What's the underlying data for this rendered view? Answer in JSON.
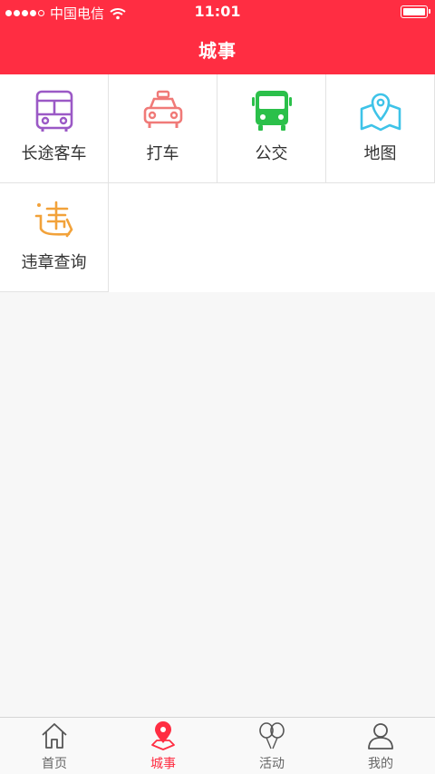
{
  "status_bar": {
    "carrier": "中国电信",
    "time": "11:01"
  },
  "header": {
    "title": "城事"
  },
  "services": [
    {
      "label": "长途客车",
      "icon": "bus-icon",
      "color": "#9b59c6"
    },
    {
      "label": "打车",
      "icon": "taxi-icon",
      "color": "#f07a78"
    },
    {
      "label": "公交",
      "icon": "city-bus-icon",
      "color": "#2bc04a"
    },
    {
      "label": "地图",
      "icon": "map-icon",
      "color": "#3ec3e8"
    },
    {
      "label": "违章查询",
      "icon": "violation-icon",
      "color": "#f2a23a"
    }
  ],
  "tabs": [
    {
      "label": "首页",
      "icon": "home-icon",
      "active": false
    },
    {
      "label": "城事",
      "icon": "location-icon",
      "active": true
    },
    {
      "label": "活动",
      "icon": "balloons-icon",
      "active": false
    },
    {
      "label": "我的",
      "icon": "user-icon",
      "active": false
    }
  ],
  "colors": {
    "brand": "#ff2d42",
    "tab_inactive": "#666666"
  }
}
